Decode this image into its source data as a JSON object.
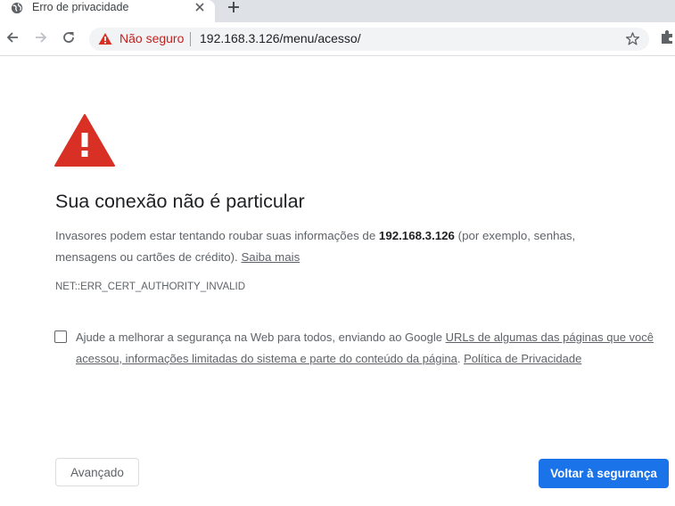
{
  "tab": {
    "title": "Erro de privacidade",
    "icon": "globe-icon"
  },
  "toolbar": {
    "security_label": "Não seguro",
    "url": "192.168.3.126/menu/acesso/"
  },
  "colors": {
    "danger": "#d93025",
    "primary": "#1a73e8",
    "text": "#202124",
    "secondary_text": "#5f6368"
  },
  "interstitial": {
    "heading": "Sua conexão não é particular",
    "body_before": "Invasores podem estar tentando roubar suas informações de ",
    "body_host": "192.168.3.126",
    "body_after": " (por exemplo, senhas, mensagens ou cartões de crédito). ",
    "learn_more": "Saiba mais",
    "error_code": "NET::ERR_CERT_AUTHORITY_INVALID",
    "optin_before": "Ajude a melhorar a segurança na Web para todos, enviando ao Google ",
    "optin_link": "URLs de algumas das páginas que você acessou, informações limitadas do sistema e parte do conteúdo da página",
    "optin_mid": ". ",
    "privacy_link": "Política de Privacidade",
    "optin_checked": false,
    "advanced_button": "Avançado",
    "back_button": "Voltar à segurança"
  }
}
